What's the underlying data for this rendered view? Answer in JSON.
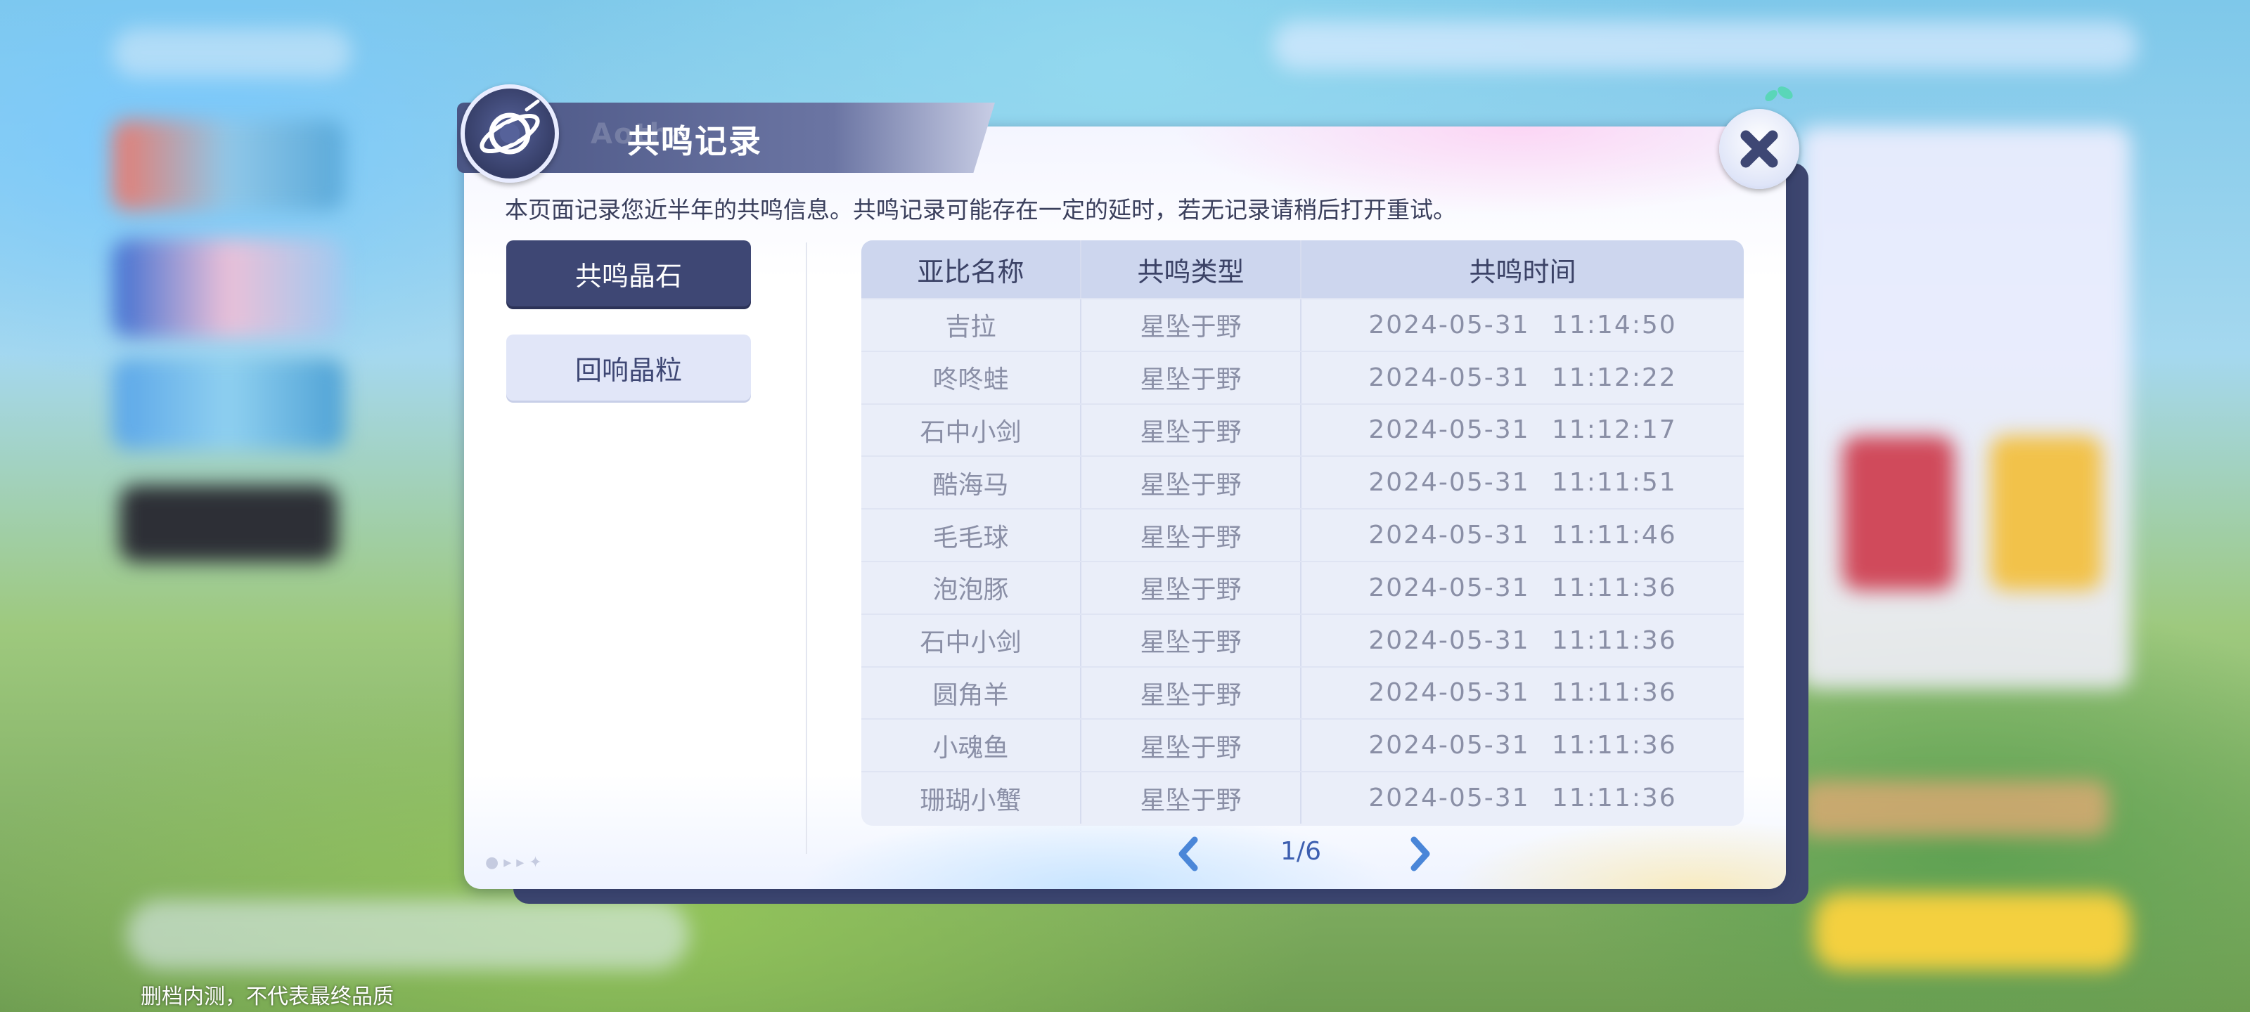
{
  "dialog": {
    "title": "共鸣记录",
    "notice": "本页面记录您近半年的共鸣信息。共鸣记录可能存在一定的延时，若无记录请稍后打开重试。"
  },
  "tabs": [
    {
      "label": "共鸣晶石",
      "active": true
    },
    {
      "label": "回响晶粒",
      "active": false
    }
  ],
  "table": {
    "headers": [
      "亚比名称",
      "共鸣类型",
      "共鸣时间"
    ],
    "rows": [
      [
        "吉拉",
        "星坠于野",
        "2024-05-31  11:14:50"
      ],
      [
        "咚咚蛙",
        "星坠于野",
        "2024-05-31  11:12:22"
      ],
      [
        "石中小剑",
        "星坠于野",
        "2024-05-31  11:12:17"
      ],
      [
        "酷海马",
        "星坠于野",
        "2024-05-31  11:11:51"
      ],
      [
        "毛毛球",
        "星坠于野",
        "2024-05-31  11:11:46"
      ],
      [
        "泡泡豚",
        "星坠于野",
        "2024-05-31  11:11:36"
      ],
      [
        "石中小剑",
        "星坠于野",
        "2024-05-31  11:11:36"
      ],
      [
        "圆角羊",
        "星坠于野",
        "2024-05-31  11:11:36"
      ],
      [
        "小魂鱼",
        "星坠于野",
        "2024-05-31  11:11:36"
      ],
      [
        "珊瑚小蟹",
        "星坠于野",
        "2024-05-31  11:11:36"
      ]
    ]
  },
  "pagination": {
    "label": "1/6"
  },
  "watermark": "删档内测，不代表最终品质",
  "icons": {
    "emblem": "planet-emblem-icon",
    "close": "close-icon",
    "prev": "chevron-left-icon",
    "next": "chevron-right-icon"
  },
  "colors": {
    "accent": "#3e4774",
    "tab_inactive": "#e1e6f8",
    "table_header": "#cdd6ee",
    "page_arrow": "#4a86d8"
  }
}
